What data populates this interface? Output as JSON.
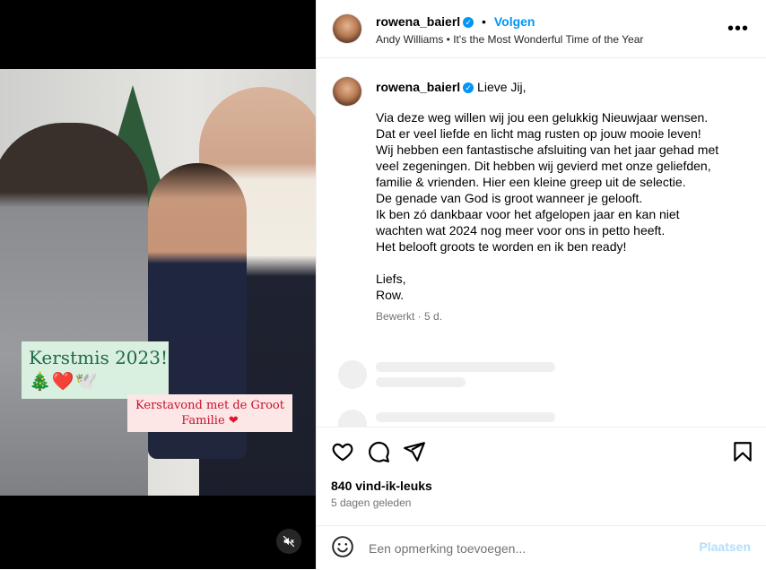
{
  "media": {
    "sticker_1_title": "Kerstmis 2023!",
    "sticker_1_emoji": "🎄❤️🕊️",
    "sticker_2_text": "Kerstavond met de Groot Familie",
    "sticker_2_heart": "❤",
    "mute_icon": "speaker-muted-icon"
  },
  "header": {
    "username": "rowena_baierl",
    "verified_mark": "✓",
    "separator": "•",
    "follow_label": "Volgen",
    "audio": "Andy Williams • It's the Most Wonderful Time of the Year",
    "more_label": "•••"
  },
  "caption": {
    "username": "rowena_baierl",
    "verified_mark": "✓",
    "first_line": "Lieve Jij,",
    "lines": [
      "Via deze weg willen wij jou een gelukkig Nieuwjaar wensen.",
      "Dat er veel liefde en licht mag rusten op jouw mooie leven!",
      "Wij hebben een fantastische afsluiting van het jaar gehad met",
      "veel zegeningen. Dit hebben wij gevierd met onze geliefden,",
      "familie & vrienden. Hier een kleine greep uit de selectie.",
      "De genade van God is groot wanneer je gelooft.",
      "Ik ben zó dankbaar voor het afgelopen jaar en kan niet",
      "wachten wat 2024 nog meer voor ons in petto heeft.",
      "Het belooft groots te worden en ik ben ready!",
      "",
      "Liefs,",
      "Row."
    ],
    "meta": "Bewerkt · 5 d."
  },
  "actions": {
    "likes": "840 vind-ik-leuks",
    "time": "5 dagen geleden"
  },
  "comment": {
    "placeholder": "Een opmerking toevoegen...",
    "post_label": "Plaatsen"
  },
  "colors": {
    "accent": "#0095f6",
    "post_disabled": "#b2dffc",
    "secondary_text": "#737373",
    "divider": "#efefef"
  }
}
